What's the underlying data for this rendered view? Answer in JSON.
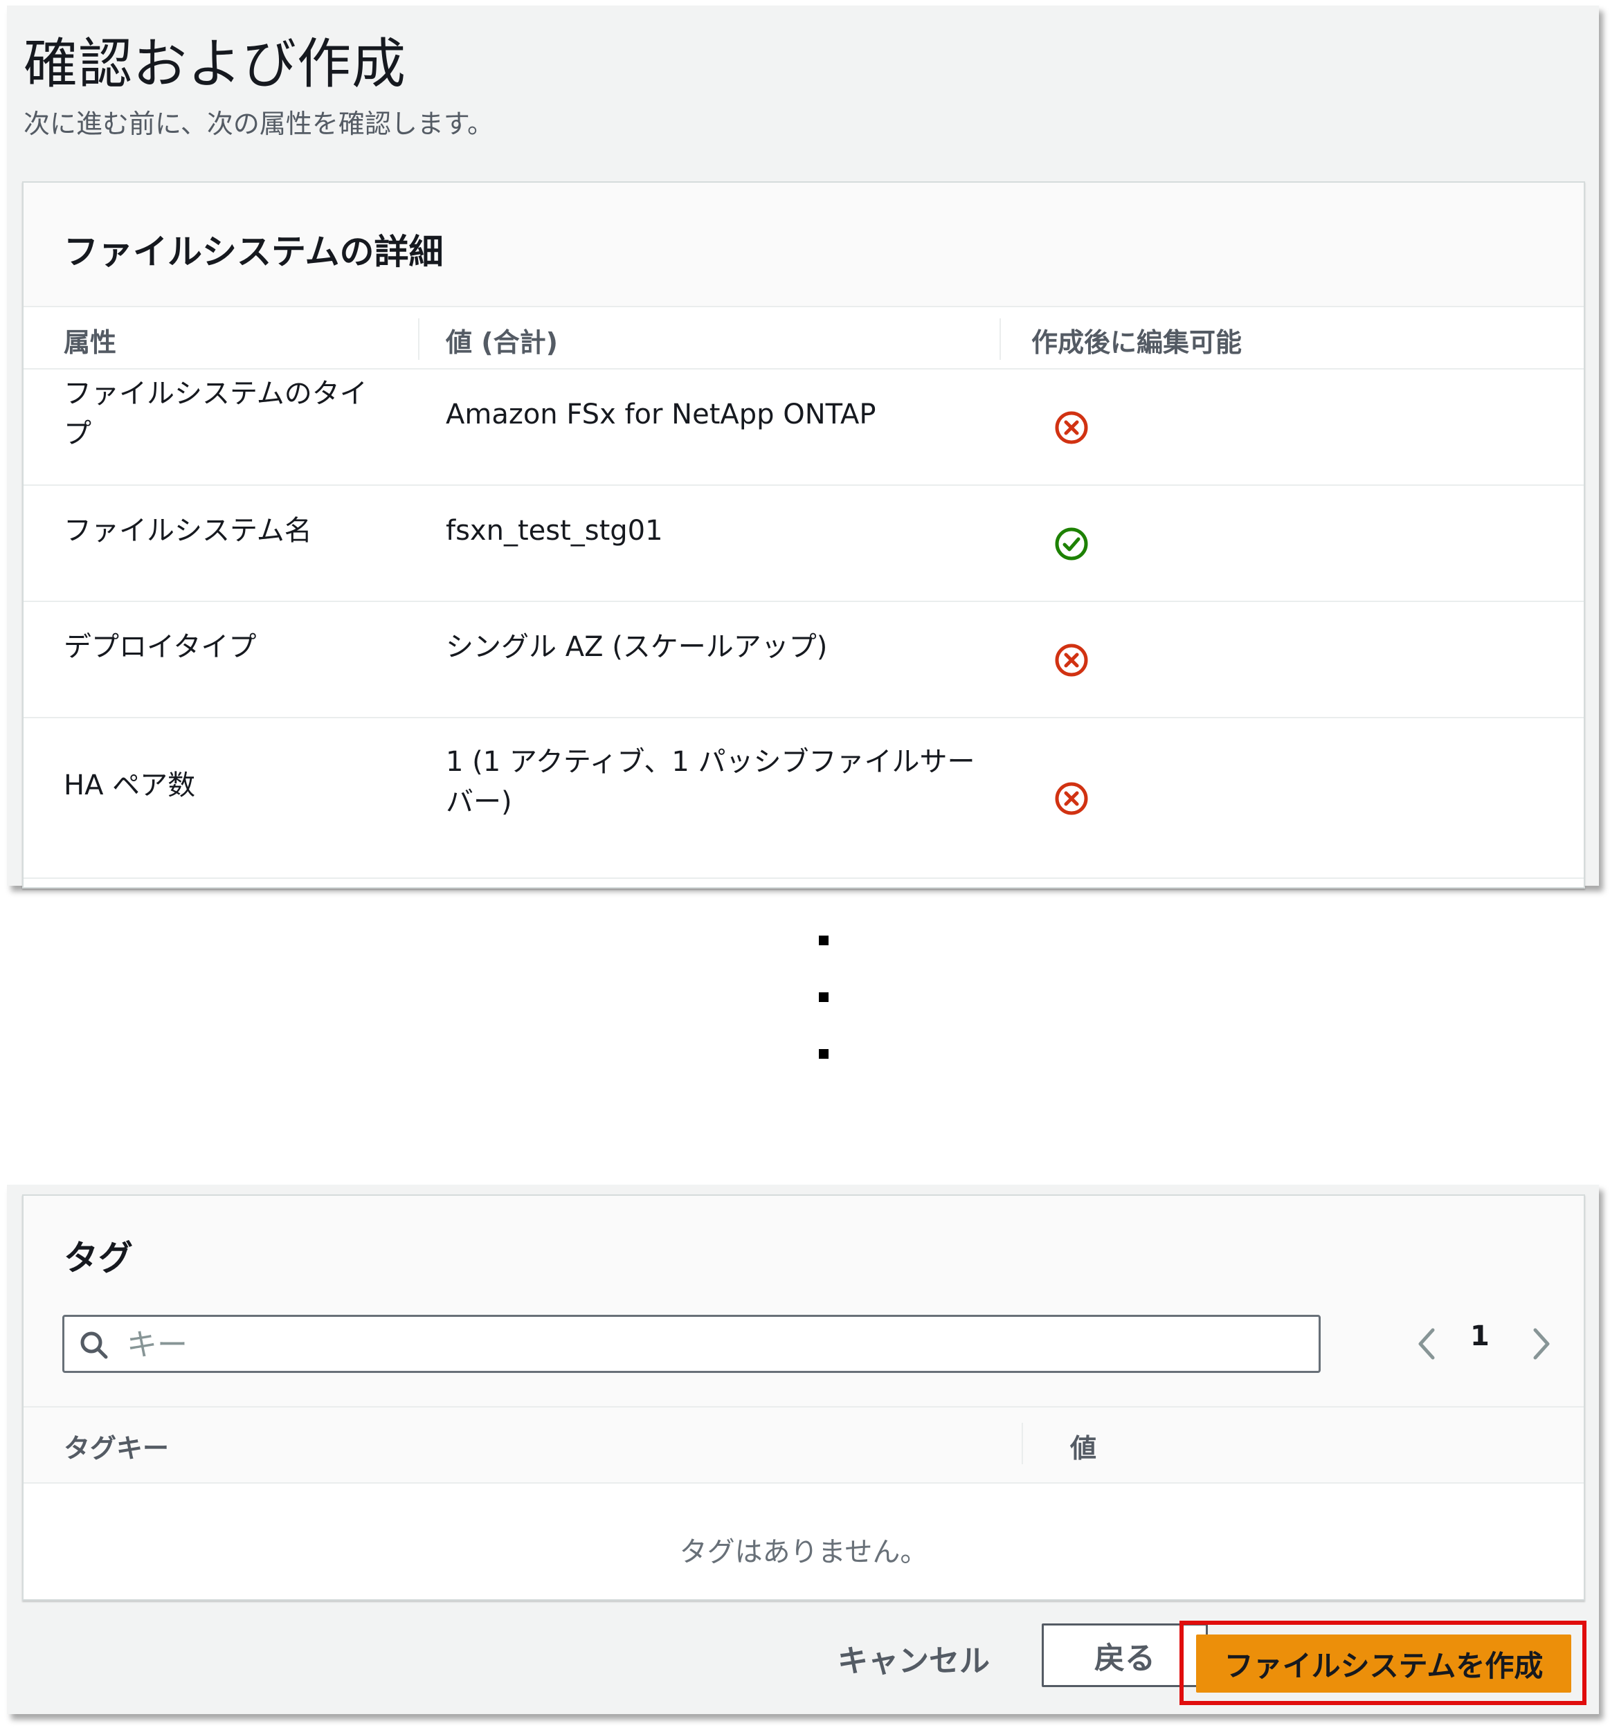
{
  "header": {
    "title": "確認および作成",
    "description": "次に進む前に、次の属性を確認します。"
  },
  "details": {
    "title": "ファイルシステムの詳細",
    "columns": [
      "属性",
      "値 (合計)",
      "作成後に編集可能"
    ],
    "rows": [
      {
        "attribute": [
          "ファイルシステムのタイ",
          "プ"
        ],
        "value": [
          "Amazon FSx for NetApp ONTAP"
        ],
        "editable": false
      },
      {
        "attribute": [
          "ファイルシステム名"
        ],
        "value": [
          "fsxn_test_stg01"
        ],
        "editable": true
      },
      {
        "attribute": [
          "デプロイタイプ"
        ],
        "value": [
          "シングル AZ (スケールアップ)"
        ],
        "editable": false
      },
      {
        "attribute": [
          "HA ペア数"
        ],
        "value": [
          "1 (1 アクティブ、1 パッシブファイルサー",
          "バー)"
        ],
        "editable": false
      }
    ]
  },
  "tags": {
    "title": "タグ",
    "search_placeholder": "キー",
    "page": "1",
    "columns": [
      "タグキー",
      "値"
    ],
    "empty_text": "タグはありません。"
  },
  "actions": {
    "cancel": "キャンセル",
    "back": "戻る",
    "create": "ファイルシステムを作成"
  },
  "colors": {
    "primary_button": "#ec8f0a",
    "highlight_border": "#e00d0d",
    "error_icon": "#d13212",
    "success_icon": "#1d8102"
  }
}
